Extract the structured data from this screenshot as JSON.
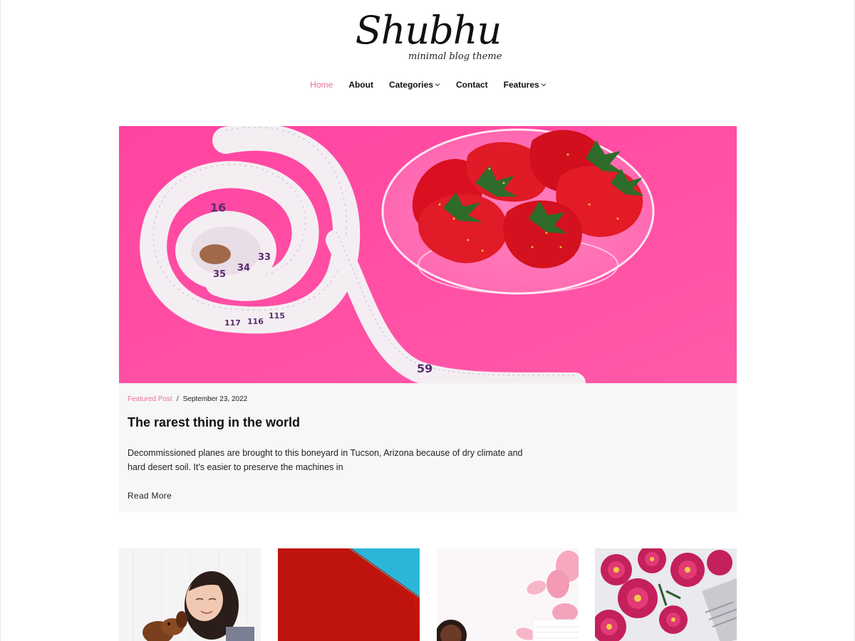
{
  "site": {
    "title": "Shubhu",
    "tagline": "minimal blog theme"
  },
  "nav": {
    "items": [
      {
        "label": "Home",
        "active": true,
        "dropdown": false
      },
      {
        "label": "About",
        "active": false,
        "dropdown": false
      },
      {
        "label": "Categories",
        "active": false,
        "dropdown": true
      },
      {
        "label": "Contact",
        "active": false,
        "dropdown": false
      },
      {
        "label": "Features",
        "active": false,
        "dropdown": true
      }
    ]
  },
  "featured": {
    "category": "Featured Post",
    "separator": "/",
    "date": "September 23, 2022",
    "title": "The rarest thing in the world",
    "excerpt": "Decommissioned planes are brought to this boneyard in Tucson, Arizona because of dry climate and hard desert soil. It's easier to preserve the machines in",
    "read_more": "Read More",
    "tape_numbers": [
      "16",
      "35",
      "34",
      "33",
      "115",
      "116",
      "117",
      "59"
    ]
  },
  "colors": {
    "accent": "#e96f98",
    "featured_bg": "#ff4fa1",
    "card_bg": "#f7f7f7"
  }
}
